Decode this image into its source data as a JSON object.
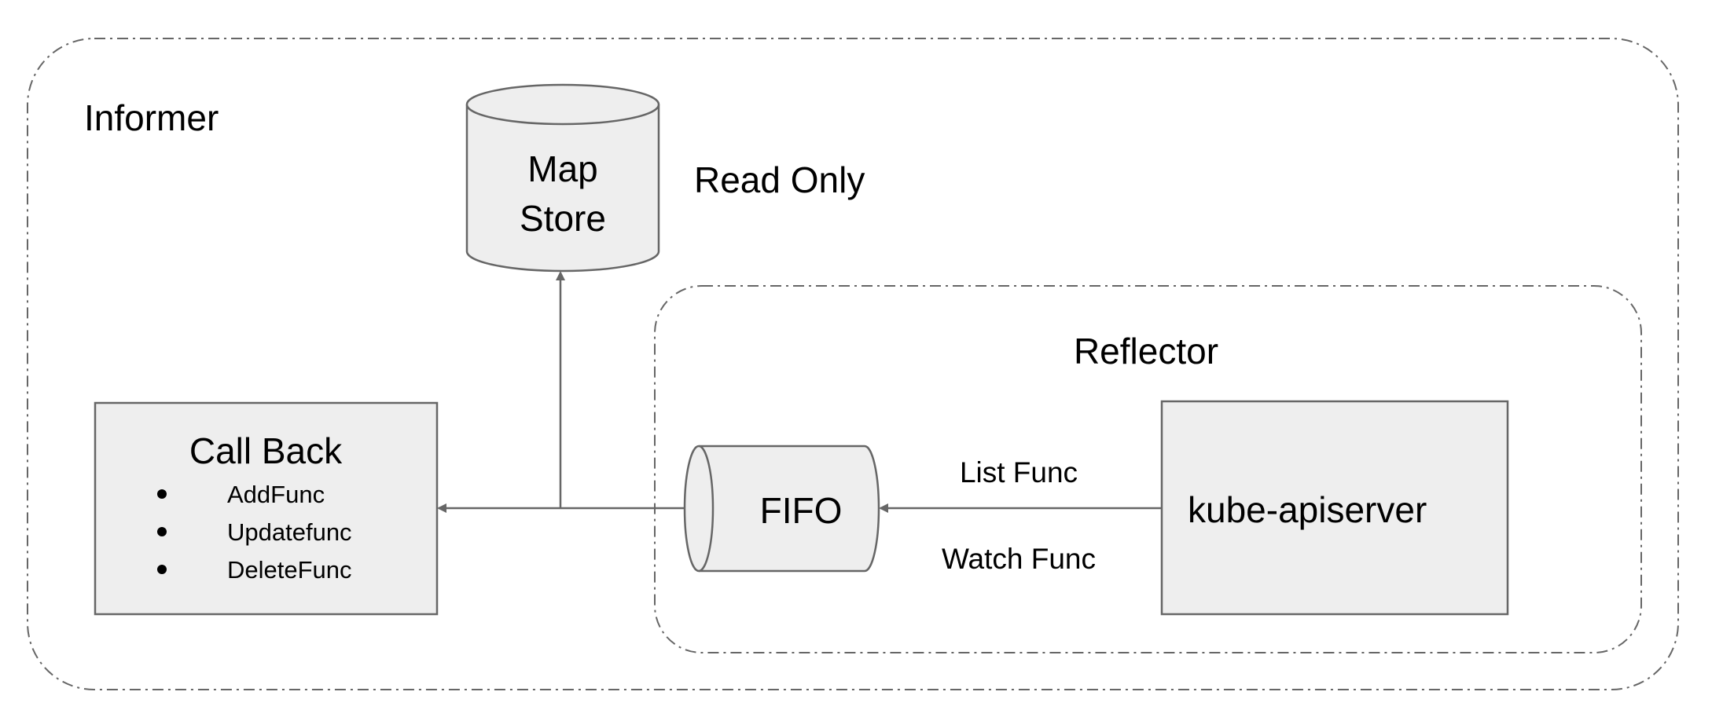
{
  "informer": {
    "label": "Informer"
  },
  "map_store": {
    "line1": "Map",
    "line2": "Store",
    "note": "Read Only"
  },
  "reflector": {
    "label": "Reflector"
  },
  "callback": {
    "title": "Call Back",
    "items": [
      "AddFunc",
      "Updatefunc",
      "DeleteFunc"
    ]
  },
  "fifo": {
    "label": "FIFO"
  },
  "edges": {
    "list": "List Func",
    "watch": "Watch Func"
  },
  "apiserver": {
    "label": "kube-apiserver"
  },
  "colors": {
    "fill": "#eeeeee",
    "stroke": "#666666",
    "text": "#000000"
  }
}
